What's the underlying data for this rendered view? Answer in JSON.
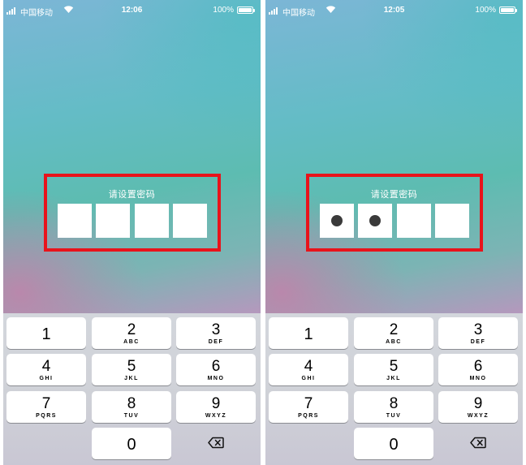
{
  "screens": [
    {
      "status": {
        "carrier": "中国移动",
        "time": "12:06",
        "battery": "100%"
      },
      "passcode": {
        "prompt": "请设置密码",
        "entered": 0,
        "length": 4
      }
    },
    {
      "status": {
        "carrier": "中国移动",
        "time": "12:05",
        "battery": "100%"
      },
      "passcode": {
        "prompt": "请设置密码",
        "entered": 2,
        "length": 4
      }
    }
  ],
  "keypad": {
    "keys": [
      {
        "num": "1",
        "letters": ""
      },
      {
        "num": "2",
        "letters": "ABC"
      },
      {
        "num": "3",
        "letters": "DEF"
      },
      {
        "num": "4",
        "letters": "GHI"
      },
      {
        "num": "5",
        "letters": "JKL"
      },
      {
        "num": "6",
        "letters": "MNO"
      },
      {
        "num": "7",
        "letters": "PQRS"
      },
      {
        "num": "8",
        "letters": "TUV"
      },
      {
        "num": "9",
        "letters": "WXYZ"
      },
      {
        "num": "0",
        "letters": ""
      }
    ],
    "delete_icon": "backspace-icon"
  },
  "colors": {
    "highlight": "#e8131b",
    "dot": "#3a3a3a"
  }
}
